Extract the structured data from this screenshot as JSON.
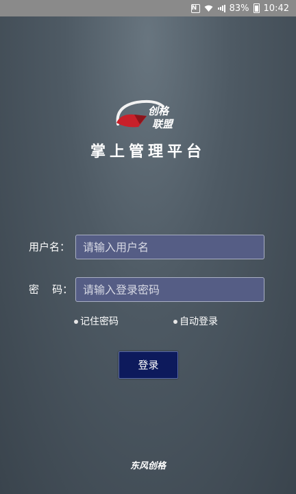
{
  "status_bar": {
    "battery": "83%",
    "time": "10:42",
    "icons": [
      "nfc-icon",
      "wifi-icon",
      "signal-icon",
      "battery-icon"
    ]
  },
  "logo": {
    "line1": "创格",
    "line2": "联盟"
  },
  "title": "掌上管理平台",
  "form": {
    "username_label": "用户名：",
    "username_placeholder": "请输入用户名",
    "password_label": "密    码：",
    "password_placeholder": "请输入登录密码",
    "remember_label": "记住密码",
    "auto_login_label": "自动登录",
    "login_label": "登录"
  },
  "footer": "东风创格",
  "colors": {
    "input_bg": "#555d85",
    "button_bg": "#0d1a5c",
    "logo_red": "#c8202a"
  }
}
